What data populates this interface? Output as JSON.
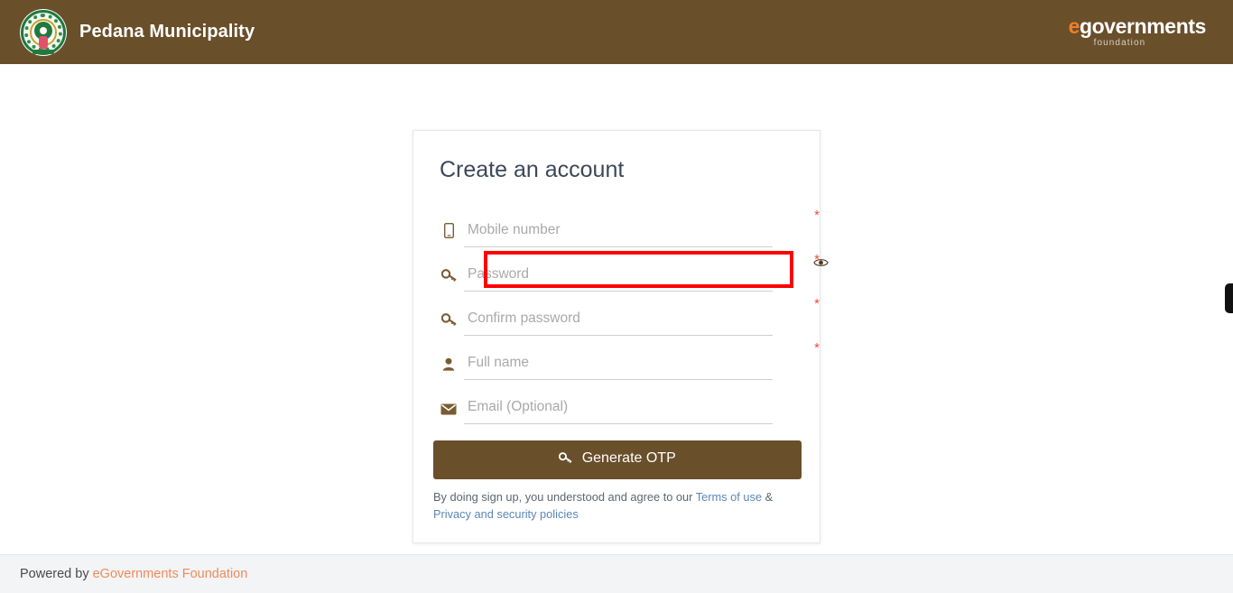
{
  "header": {
    "emblem_icon": "state-emblem-icon",
    "title": "Pedana Municipality",
    "logo": {
      "e": "e",
      "main": "governments",
      "sub": "foundation"
    }
  },
  "card": {
    "title": "Create an account",
    "fields": [
      {
        "name": "mobile-number",
        "icon": "mobile-phone-icon",
        "placeholder": "Mobile number",
        "value": "",
        "required": "*",
        "type": "text"
      },
      {
        "name": "password",
        "icon": "key-icon",
        "placeholder": "Password",
        "value": "",
        "required": "*",
        "type": "password",
        "eye_icon": "eye-icon",
        "highlighted": true
      },
      {
        "name": "confirm-password",
        "icon": "key-icon",
        "placeholder": "Confirm password",
        "value": "",
        "required": "*",
        "type": "password"
      },
      {
        "name": "full-name",
        "icon": "user-icon",
        "placeholder": "Full name",
        "value": "",
        "required": "*",
        "type": "text"
      },
      {
        "name": "email",
        "icon": "envelope-icon",
        "placeholder": "Email (Optional)",
        "value": "",
        "required": "",
        "type": "email"
      }
    ],
    "submit_label": "Generate OTP",
    "submit_icon": "key-icon",
    "terms": {
      "prefix": "By doing sign up, you understood and agree to our ",
      "link1": "Terms of use",
      "middle": " & ",
      "link2": "Privacy and security policies"
    }
  },
  "footer": {
    "prefix": "Powered by ",
    "link": "eGovernments Foundation"
  },
  "colors": {
    "header_brown": "#6a4f2b",
    "accent_orange": "#f07f29",
    "required_red": "#e74c3c",
    "highlight_red": "#ff0000",
    "link_blue": "#5b87b5",
    "footer_bg": "#f3f4f5"
  }
}
